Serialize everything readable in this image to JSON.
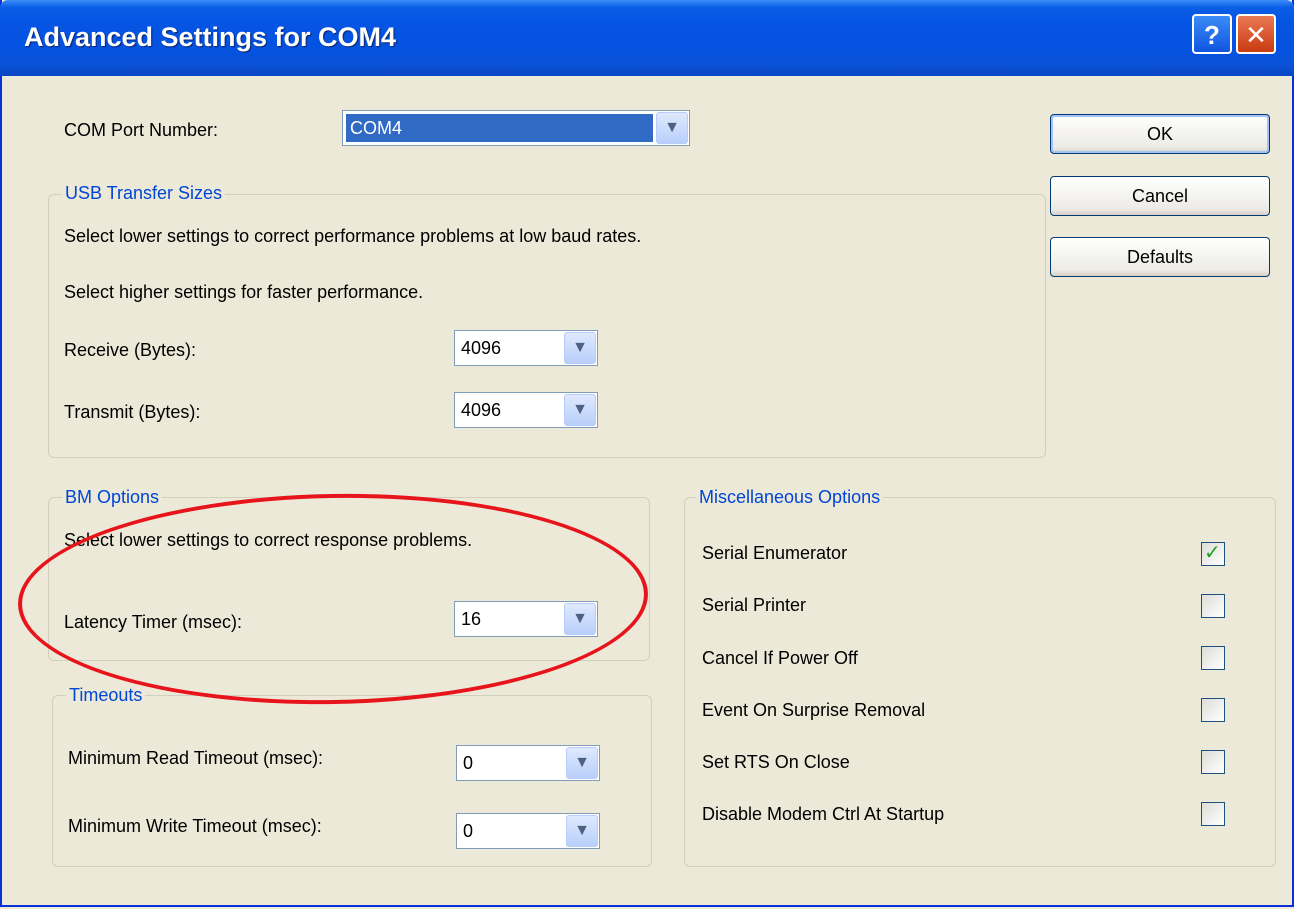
{
  "window": {
    "title": "Advanced Settings for COM4",
    "help_glyph": "?",
    "close_glyph": "✕"
  },
  "com_port": {
    "label": "COM Port Number:",
    "value": "COM4"
  },
  "usb_transfer": {
    "title": "USB Transfer Sizes",
    "line1": "Select lower settings to correct performance problems at low baud rates.",
    "line2": "Select higher settings for faster performance.",
    "receive_label": "Receive (Bytes):",
    "receive_value": "4096",
    "transmit_label": "Transmit (Bytes):",
    "transmit_value": "4096"
  },
  "bm_options": {
    "title": "BM Options",
    "line1": "Select lower settings to correct response problems.",
    "latency_label": "Latency Timer (msec):",
    "latency_value": "16"
  },
  "timeouts": {
    "title": "Timeouts",
    "read_label": "Minimum Read Timeout (msec):",
    "read_value": "0",
    "write_label": "Minimum Write Timeout (msec):",
    "write_value": "0"
  },
  "misc": {
    "title": "Miscellaneous Options",
    "items": [
      {
        "label": "Serial Enumerator",
        "checked": true
      },
      {
        "label": "Serial Printer",
        "checked": false
      },
      {
        "label": "Cancel If Power Off",
        "checked": false
      },
      {
        "label": "Event On Surprise Removal",
        "checked": false
      },
      {
        "label": "Set RTS On Close",
        "checked": false
      },
      {
        "label": "Disable Modem Ctrl At Startup",
        "checked": false
      }
    ]
  },
  "buttons": {
    "ok": "OK",
    "cancel": "Cancel",
    "defaults": "Defaults"
  },
  "icons": {
    "dropdown": "chevron-down-icon",
    "check": "checkmark-icon"
  },
  "colors": {
    "titlebar": "#0554e3",
    "group_title": "#0046d5",
    "annotation": "#e8141b",
    "selection": "#316ac5"
  }
}
